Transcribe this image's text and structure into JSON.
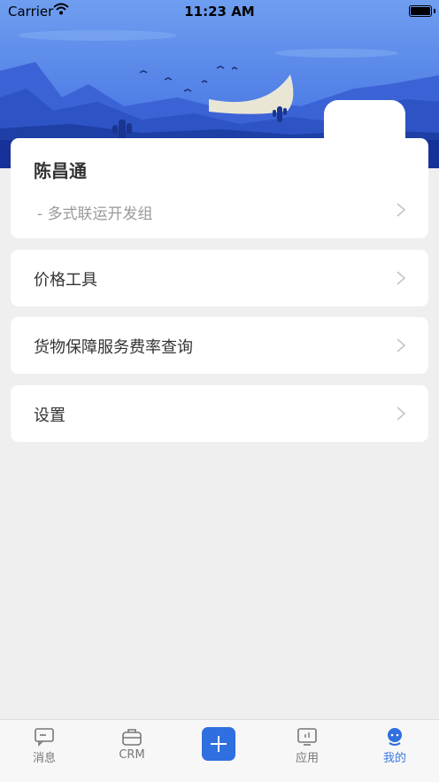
{
  "status_bar": {
    "carrier": "Carrier",
    "time": "11:23 AM"
  },
  "profile": {
    "name": "陈昌通",
    "department": "- 多式联运开发组"
  },
  "menu": {
    "items": [
      {
        "label": "价格工具"
      },
      {
        "label": "货物保障服务费率查询"
      },
      {
        "label": "设置"
      }
    ]
  },
  "tabbar": {
    "items": [
      {
        "label": "消息",
        "icon": "message-icon"
      },
      {
        "label": "CRM",
        "icon": "briefcase-icon"
      },
      {
        "label": "",
        "icon": "add-icon"
      },
      {
        "label": "应用",
        "icon": "monitor-icon"
      },
      {
        "label": "我的",
        "icon": "person-icon",
        "active": true
      }
    ]
  },
  "colors": {
    "accent": "#2f6fe0",
    "hero_blue": "#2f57c9",
    "background": "#efefef"
  }
}
